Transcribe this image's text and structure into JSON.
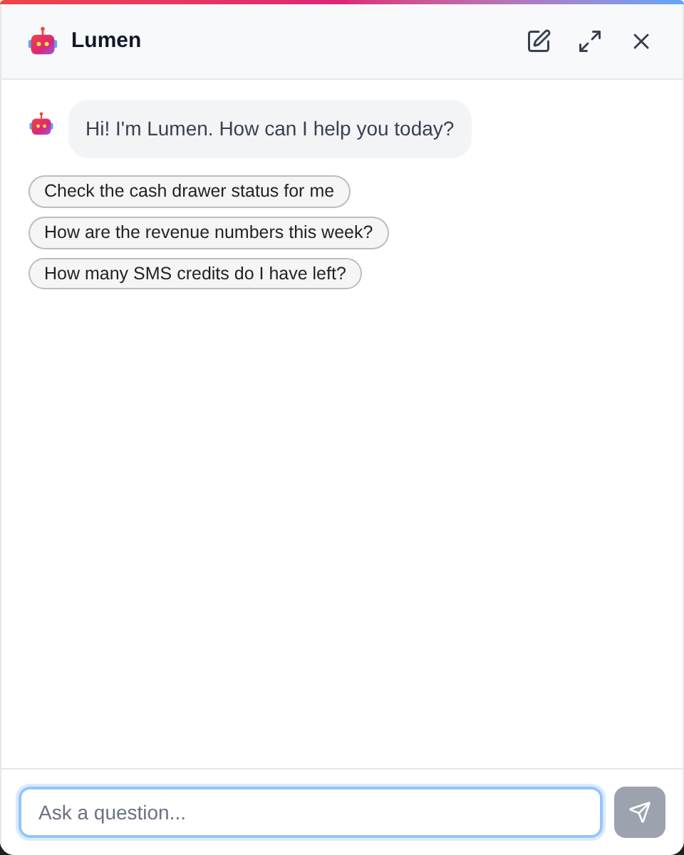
{
  "header": {
    "title": "Lumen"
  },
  "messages": [
    {
      "kind": "assistant",
      "text": "Hi! I'm Lumen. How can I help you today?"
    }
  ],
  "suggestions": [
    "Check the cash drawer status for me",
    "How are the revenue numbers this week?",
    "How many SMS credits do I have left?"
  ],
  "composer": {
    "placeholder": "Ask a question...",
    "focused": true,
    "send_disabled": true
  }
}
